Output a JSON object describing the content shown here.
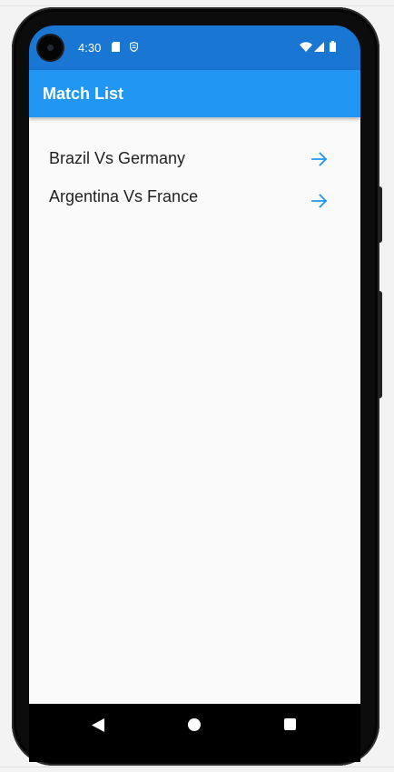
{
  "status_bar": {
    "time": "4:30",
    "left_icons": [
      "sd-card-icon",
      "shield-icon"
    ],
    "right_icons": [
      "wifi-icon",
      "signal-icon",
      "battery-icon"
    ],
    "color": "#1976d2"
  },
  "app_bar": {
    "title": "Match List",
    "color": "#2196f3"
  },
  "matches": [
    {
      "label": "Brazil Vs Germany",
      "icon": "arrow-forward-icon"
    },
    {
      "label": "Argentina Vs France",
      "icon": "arrow-forward-icon"
    }
  ],
  "nav_bar": {
    "icons": [
      "back-icon",
      "home-icon",
      "recents-icon"
    ]
  },
  "colors": {
    "accent": "#2196f3",
    "background": "#fafafa",
    "text": "#222222"
  }
}
